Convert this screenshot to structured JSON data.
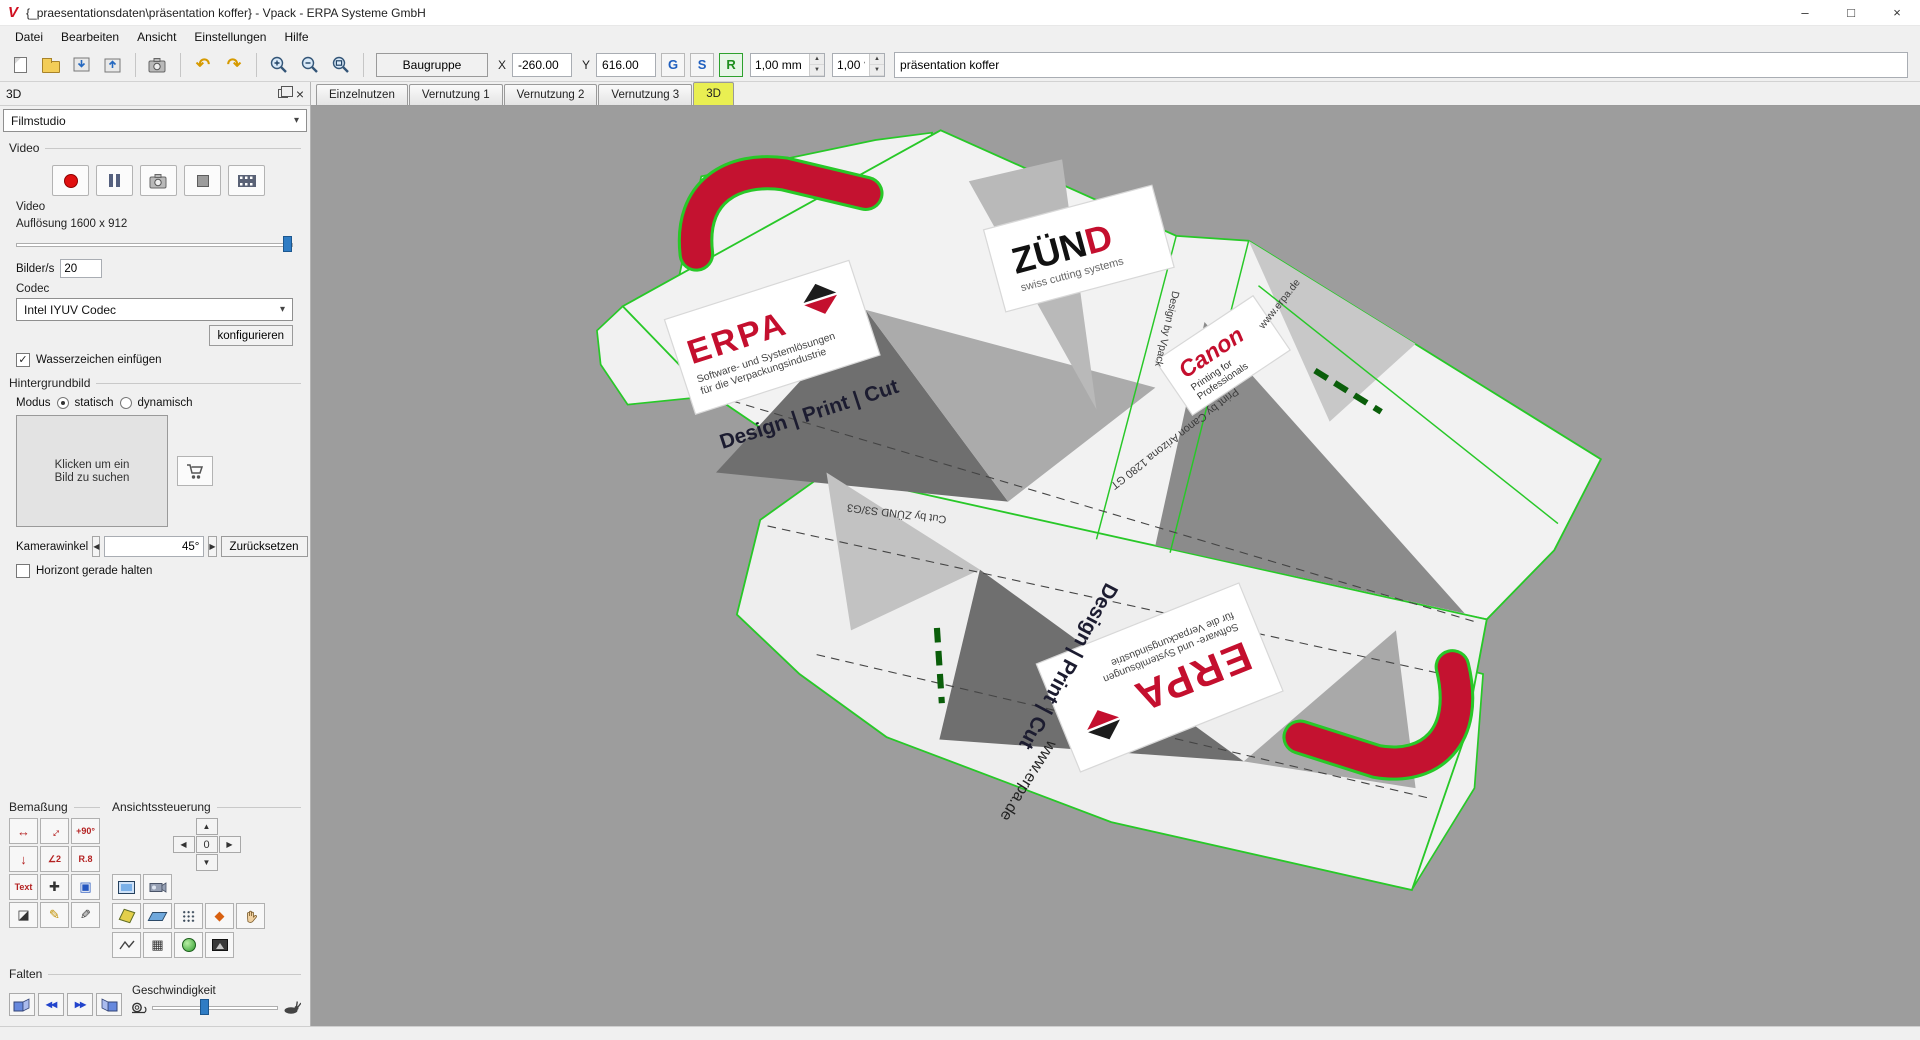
{
  "window": {
    "icon_letter": "V",
    "title": "{_praesentationsdaten\\präsentation koffer} - Vpack - ERPA Systeme GmbH",
    "controls": {
      "minimize": "–",
      "maximize": "□",
      "close": "×"
    }
  },
  "menubar": {
    "items": [
      "Datei",
      "Bearbeiten",
      "Ansicht",
      "Einstellungen",
      "Hilfe"
    ]
  },
  "toolbar": {
    "baugruppe_label": "Baugruppe",
    "x_label": "X",
    "x_value": "-260.00",
    "y_label": "Y",
    "y_value": "616.00",
    "g_label": "G",
    "s_label": "S",
    "r_label": "R",
    "step_mm_value": "1,00 mm",
    "step_deg_value": "1,00 °",
    "name_value": "präsentation koffer"
  },
  "icons": {
    "dropdown": "▾",
    "undo": "↶",
    "redo": "↷",
    "check": "✓",
    "close": "×",
    "spin_up": "▲",
    "spin_down": "▼",
    "left": "◀",
    "right": "▶",
    "up": "▲",
    "down": "▼",
    "rewind": "◀◀",
    "forward": "▶▶",
    "move_tool": "✚",
    "pencil": "✎",
    "grid": "▦",
    "diamond": "◆",
    "dim_horizontal": "↔",
    "dim_arrow": "↓",
    "select_rect": "▣",
    "eraser": "◪"
  },
  "panel": {
    "title": "3D",
    "mode_select_value": "Filmstudio",
    "video": {
      "group_label": "Video",
      "video_label": "Video",
      "resolution_label": "Auflösung 1600 x 912",
      "fps_label": "Bilder/s",
      "fps_value": "20",
      "codec_label": "Codec",
      "codec_value": "Intel IYUV Codec",
      "configure_label": "konfigurieren",
      "watermark_label": "Wasserzeichen einfügen"
    },
    "background": {
      "group_label": "Hintergrundbild",
      "mode_label": "Modus",
      "static_label": "statisch",
      "dynamic_label": "dynamisch",
      "placeholder_line1": "Klicken um ein",
      "placeholder_line2": "Bild zu suchen",
      "camera_label": "Kamerawinkel",
      "camera_value": "45°",
      "reset_label": "Zurücksetzen",
      "horizon_label": "Horizont gerade halten"
    },
    "bemassung": {
      "group_label": "Bemaßung",
      "text_tool_label": "Text",
      "plus90_label": "+90°",
      "radius_label": "R.8",
      "angle_label": "∠2"
    },
    "ansicht": {
      "group_label": "Ansichtssteuerung",
      "zero_label": "0"
    },
    "falten": {
      "group_label": "Falten",
      "speed_label": "Geschwindigkeit"
    }
  },
  "tabs": {
    "items": [
      {
        "label": "Einzelnutzen",
        "active": false
      },
      {
        "label": "Vernutzung 1",
        "active": false
      },
      {
        "label": "Vernutzung 2",
        "active": false
      },
      {
        "label": "Vernutzung 3",
        "active": false
      },
      {
        "label": "3D",
        "active": true
      }
    ]
  },
  "viewport": {
    "labels": {
      "erpa": "ERPA",
      "erpa_tag1": "Software- und Systemlösungen",
      "erpa_tag2": "für die Verpackungsindustrie",
      "design_print_cut": "Design | Print | Cut",
      "zund_a": "ZÜN",
      "zund_b": "D",
      "zund_tag": "swiss cutting systems",
      "canon": "Canon",
      "canon_tag1": "Printing for",
      "canon_tag2": "Professionals",
      "www": "www.erpa.de",
      "cut_by": "Cut by ZÜND S3/G3",
      "print_by": "Print by Canon Arizona 1280 GT",
      "design_by": "Design by Vpack"
    },
    "colors": {
      "cut_line_green": "#28c828",
      "handle_red": "#c41230",
      "background_gray": "#9d9d9d",
      "active_tab_yellow": "#e9ef52",
      "erpa_red": "#c40f2e"
    }
  }
}
